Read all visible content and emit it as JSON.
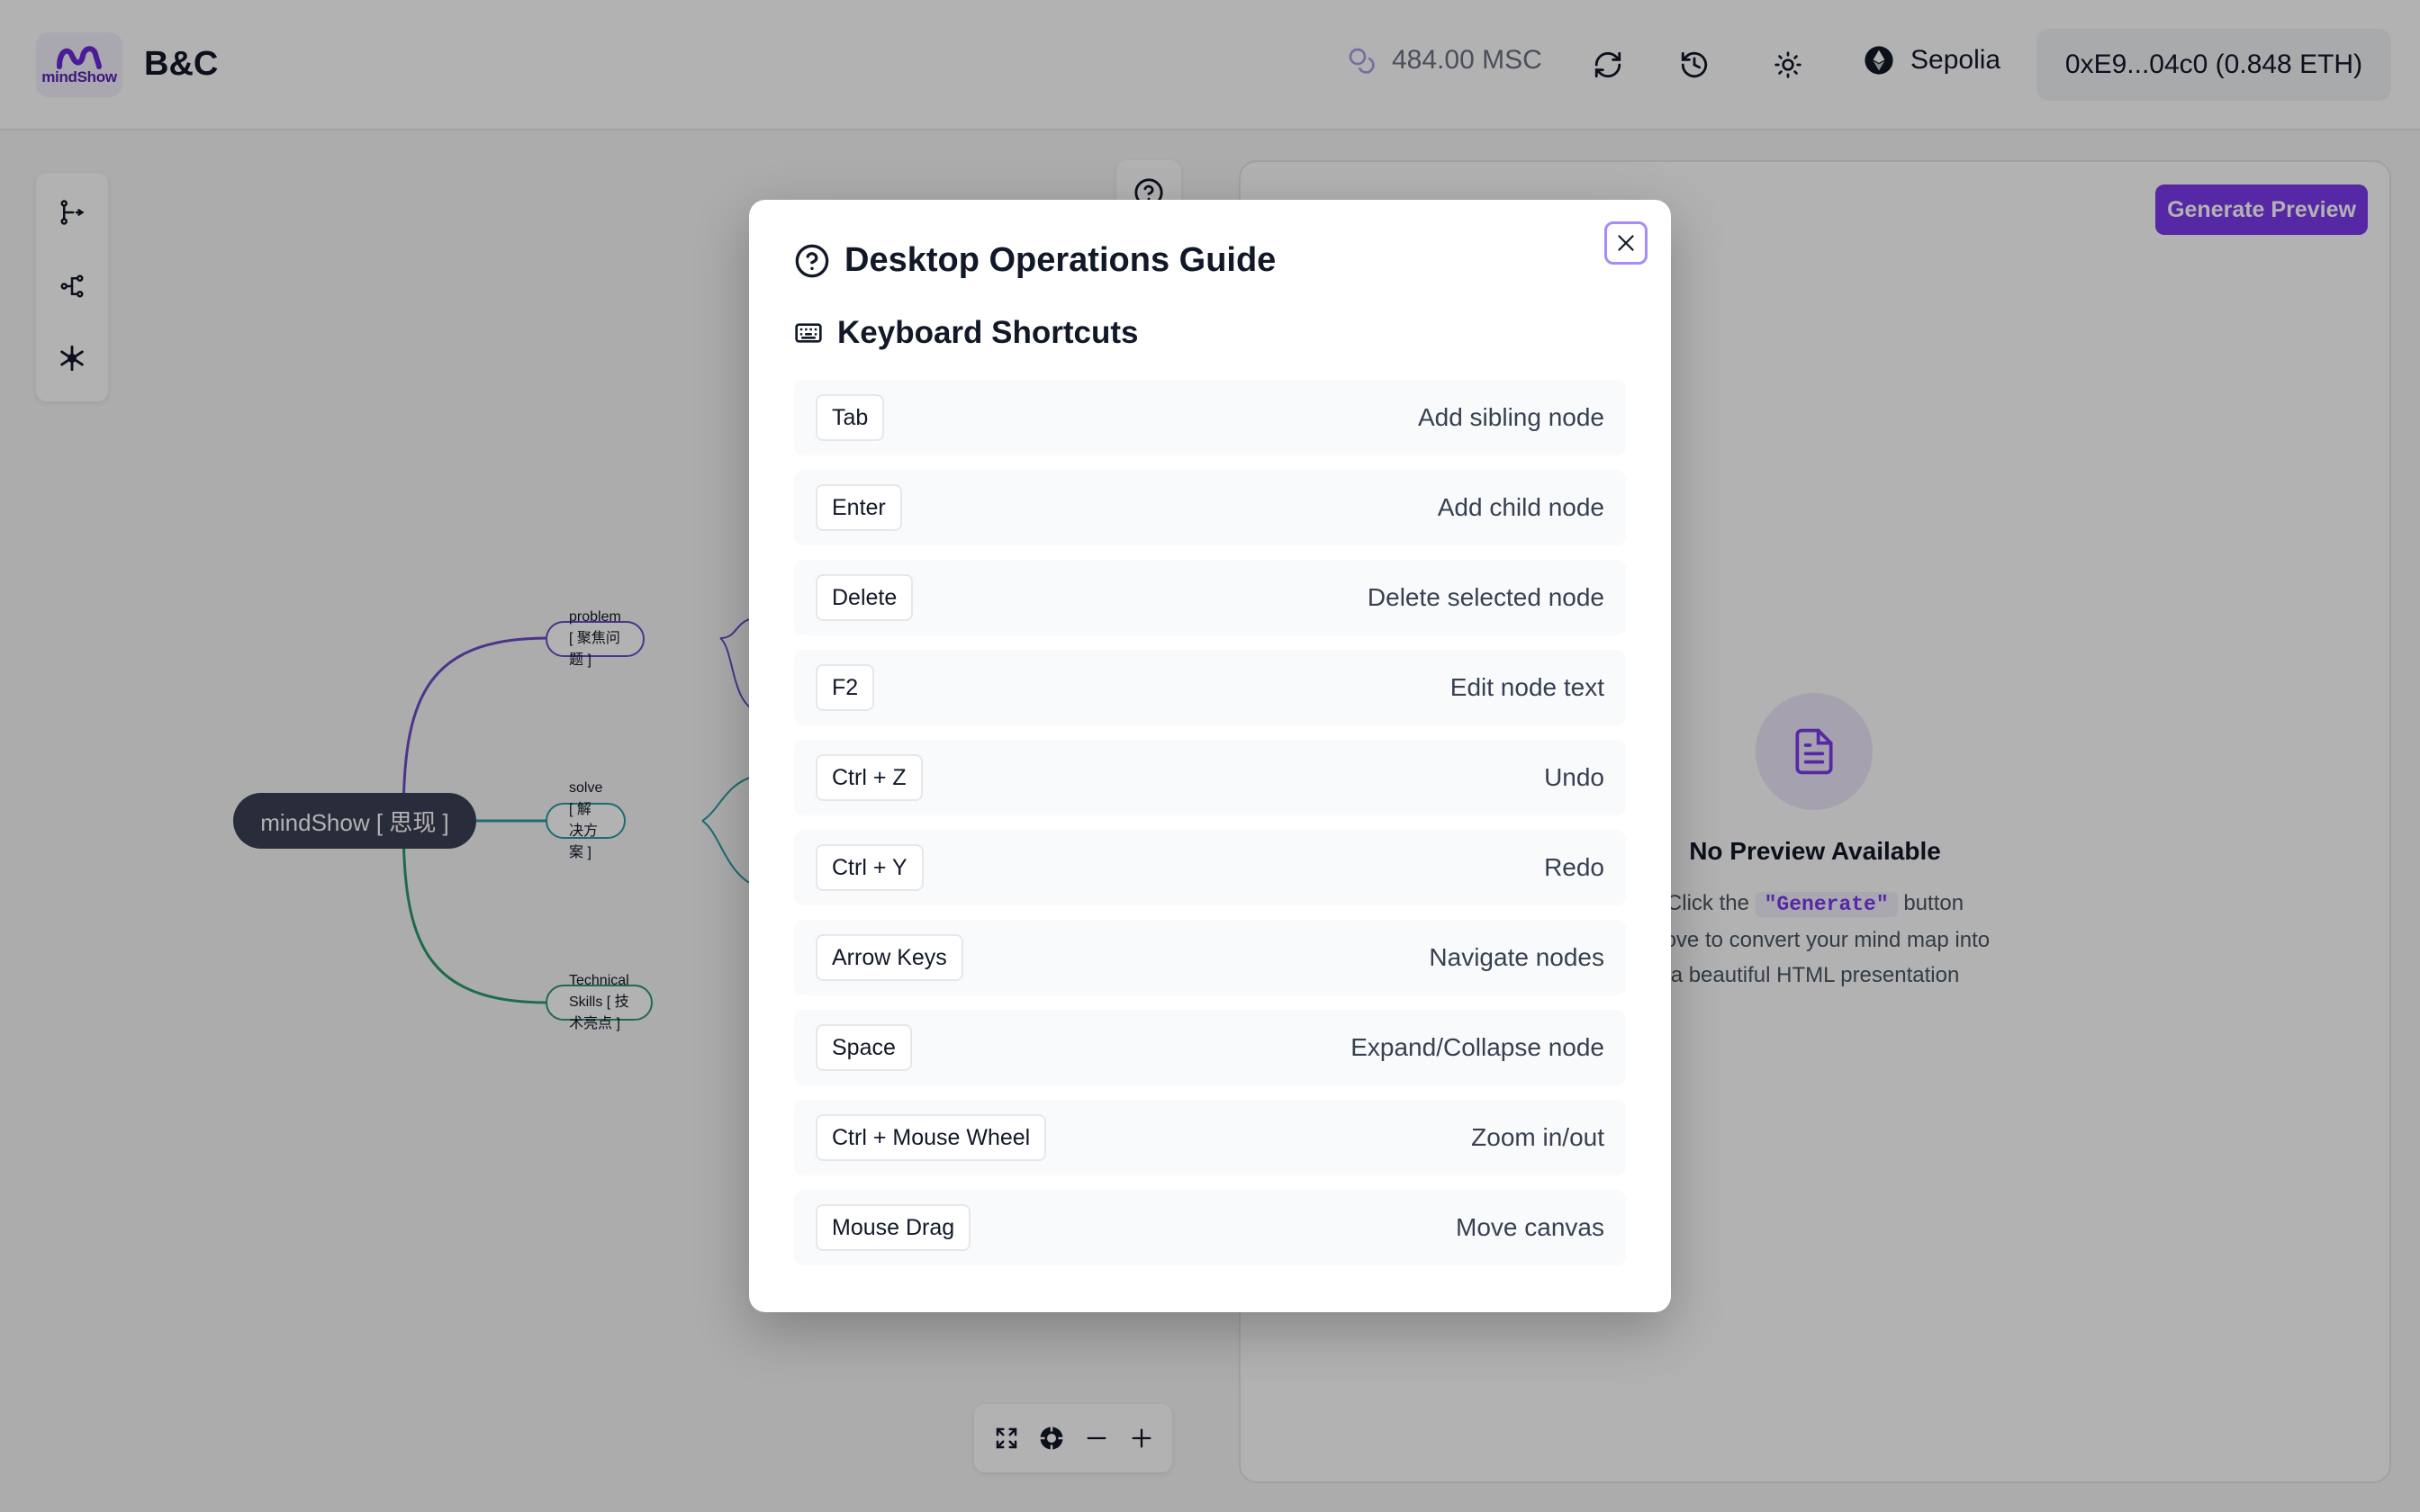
{
  "header": {
    "logo_text": "mindShow",
    "app_title": "B&C",
    "balance": "484.00 MSC",
    "network": "Sepolia",
    "wallet": "0xE9...04c0 (0.848 ETH)",
    "icons": [
      "coins-icon",
      "refresh-icon",
      "history-icon",
      "sun-icon",
      "ethereum-icon"
    ]
  },
  "mindmap": {
    "root": "mindShow [ 思现 ]",
    "children": [
      {
        "label": "problem [ 聚焦问题 ]",
        "color": "#6d4bc8"
      },
      {
        "label": "solve [ 解决方案 ]",
        "color": "#2a9aa8"
      },
      {
        "label": "Technical Skills [ 技术亮点 ]",
        "color": "#2a9a6a"
      }
    ]
  },
  "preview": {
    "generate_button": "Generate Preview",
    "empty_title": "No Preview Available",
    "empty_desc_before": "Click the",
    "empty_desc_code": "\"Generate\"",
    "empty_desc_after": "button above to convert your mind map into a beautiful HTML presentation"
  },
  "modal": {
    "title": "Desktop Operations Guide",
    "section_title": "Keyboard Shortcuts",
    "shortcuts": [
      {
        "key": "Tab",
        "action": "Add sibling node"
      },
      {
        "key": "Enter",
        "action": "Add child node"
      },
      {
        "key": "Delete",
        "action": "Delete selected node"
      },
      {
        "key": "F2",
        "action": "Edit node text"
      },
      {
        "key": "Ctrl + Z",
        "action": "Undo"
      },
      {
        "key": "Ctrl + Y",
        "action": "Redo"
      },
      {
        "key": "Arrow Keys",
        "action": "Navigate nodes"
      },
      {
        "key": "Space",
        "action": "Expand/Collapse node"
      },
      {
        "key": "Ctrl + Mouse Wheel",
        "action": "Zoom in/out"
      },
      {
        "key": "Mouse Drag",
        "action": "Move canvas"
      }
    ]
  },
  "colors": {
    "accent": "#7c3aed",
    "root_node": "#3c3f55"
  }
}
